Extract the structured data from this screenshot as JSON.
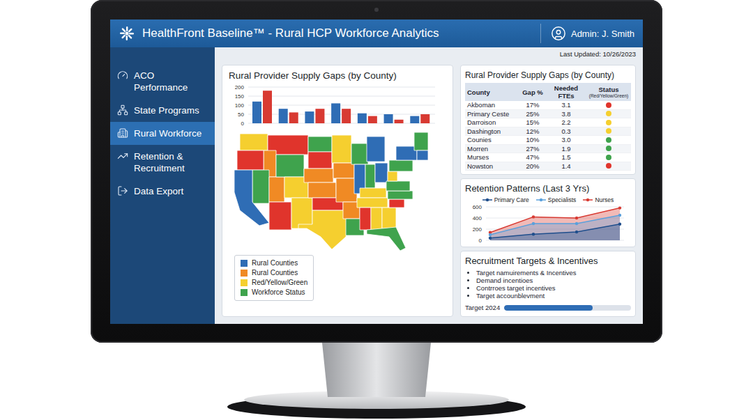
{
  "header": {
    "title": "HealthFront Baseline™ - Rural HCP Workforce Analytics",
    "user": "Admin: J. Smith"
  },
  "sidebar": {
    "items": [
      {
        "label": "ACO Performance",
        "selected": false
      },
      {
        "label": "State Programs",
        "selected": false
      },
      {
        "label": "Rural Workforce",
        "selected": true
      },
      {
        "label": "Retention & Recruitment",
        "selected": false
      },
      {
        "label": "Data Export",
        "selected": false
      }
    ]
  },
  "last_updated": "Last Updated: 10/26/2023",
  "supply_chart": {
    "title": "Rural Provider Supply Gaps (by County)",
    "ticks": [
      "200",
      "150",
      "100",
      "50",
      "0"
    ],
    "max": 200,
    "series": [
      {
        "color": "#2f6db5",
        "values": [
          120,
          80,
          65,
          110,
          55,
          50,
          40
        ]
      },
      {
        "color": "#d83a32",
        "values": [
          180,
          60,
          80,
          80,
          40,
          20,
          50
        ]
      }
    ]
  },
  "map": {
    "regions": [
      {
        "color": "#f5cf2f"
      },
      {
        "color": "#e0342c"
      },
      {
        "color": "#f08a24"
      },
      {
        "color": "#e0342c"
      },
      {
        "color": "#3fa34d"
      },
      {
        "color": "#2f6db5"
      },
      {
        "color": "#f08a24"
      },
      {
        "color": "#3fa34d"
      },
      {
        "color": "#f5cf2f"
      },
      {
        "color": "#e0342c"
      },
      {
        "color": "#f5cf2f"
      },
      {
        "color": "#3fa34d"
      },
      {
        "color": "#e0342c"
      },
      {
        "color": "#f08a24"
      },
      {
        "color": "#f08a24"
      },
      {
        "color": "#e0342c"
      },
      {
        "color": "#f5cf2f"
      },
      {
        "color": "#f5cf2f"
      },
      {
        "color": "#f08a24"
      },
      {
        "color": "#f08a24"
      },
      {
        "color": "#f08a24"
      },
      {
        "color": "#3fa34d"
      },
      {
        "color": "#3fa34d"
      },
      {
        "color": "#2f6db5"
      },
      {
        "color": "#2f6db5"
      },
      {
        "color": "#3fa34d"
      },
      {
        "color": "#2f6db5"
      },
      {
        "color": "#f5cf2f"
      },
      {
        "color": "#f5cf2f"
      },
      {
        "color": "#e0342c"
      },
      {
        "color": "#f5cf2f"
      },
      {
        "color": "#f5cf2f"
      },
      {
        "color": "#3fa34d"
      },
      {
        "color": "#e0342c"
      },
      {
        "color": "#3fa34d"
      },
      {
        "color": "#3fa34d"
      },
      {
        "color": "#f5cf2f"
      },
      {
        "color": "#3fa34d"
      },
      {
        "color": "#2f6db5"
      },
      {
        "color": "#3fa34d"
      },
      {
        "color": "#2f6db5"
      }
    ],
    "legend": [
      {
        "label": "Rural Counties",
        "color": "#2f6db5"
      },
      {
        "label": "Rural Counties",
        "color": "#f08a24"
      },
      {
        "label": "Red/Yellow/Green",
        "color": "#f5cf2f"
      },
      {
        "label": "Workforce Status",
        "color": "#3fa34d"
      }
    ]
  },
  "table": {
    "title": "Rural Provider Supply Gaps (by County)",
    "columns": [
      {
        "label": "County",
        "note": ""
      },
      {
        "label": "Gap %",
        "note": ""
      },
      {
        "label": "Needed FTEs",
        "note": ""
      },
      {
        "label": "Status",
        "note": "(Red/Yellow/Green)"
      }
    ],
    "rows": [
      {
        "county": "Akboman",
        "gap": "17%",
        "ftes": "3.1",
        "color": "#e0342c"
      },
      {
        "county": "Primary Ceste",
        "gap": "25%",
        "ftes": "3.8",
        "color": "#f5cf2f"
      },
      {
        "county": "Darroison",
        "gap": "15%",
        "ftes": "2.2",
        "color": "#f5cf2f"
      },
      {
        "county": "Dashington",
        "gap": "12%",
        "ftes": "0.3",
        "color": "#f5cf2f"
      },
      {
        "county": "Counies",
        "gap": "10%",
        "ftes": "3.0",
        "color": "#3fa34d"
      },
      {
        "county": "Morren",
        "gap": "27%",
        "ftes": "1.9",
        "color": "#3fa34d"
      },
      {
        "county": "Murses",
        "gap": "47%",
        "ftes": "1.5",
        "color": "#3fa34d"
      },
      {
        "county": "Nowston",
        "gap": "20%",
        "ftes": "1.4",
        "color": "#e0342c"
      }
    ]
  },
  "retention": {
    "title": "Retention Patterns (Last 3 Yrs)",
    "ticks": [
      "600",
      "400",
      "200",
      "0"
    ],
    "max": 600,
    "series": [
      {
        "name": "Primary Care",
        "color": "#1f4e8c",
        "values": [
          40,
          110,
          150,
          290
        ]
      },
      {
        "name": "Specialists",
        "color": "#5aa0dc",
        "values": [
          100,
          300,
          300,
          450
        ]
      },
      {
        "name": "Nurses",
        "color": "#d83a32",
        "values": [
          140,
          420,
          400,
          580
        ]
      }
    ]
  },
  "recruitment": {
    "title": "Recruitment Targets & Incentives",
    "bullets": [
      "Target namuirements & Incentives",
      "Demand incentioes",
      "Contrroes target incentives",
      "Target accounblevment"
    ],
    "target": {
      "label": "Target 2024",
      "level": 0.7
    }
  }
}
